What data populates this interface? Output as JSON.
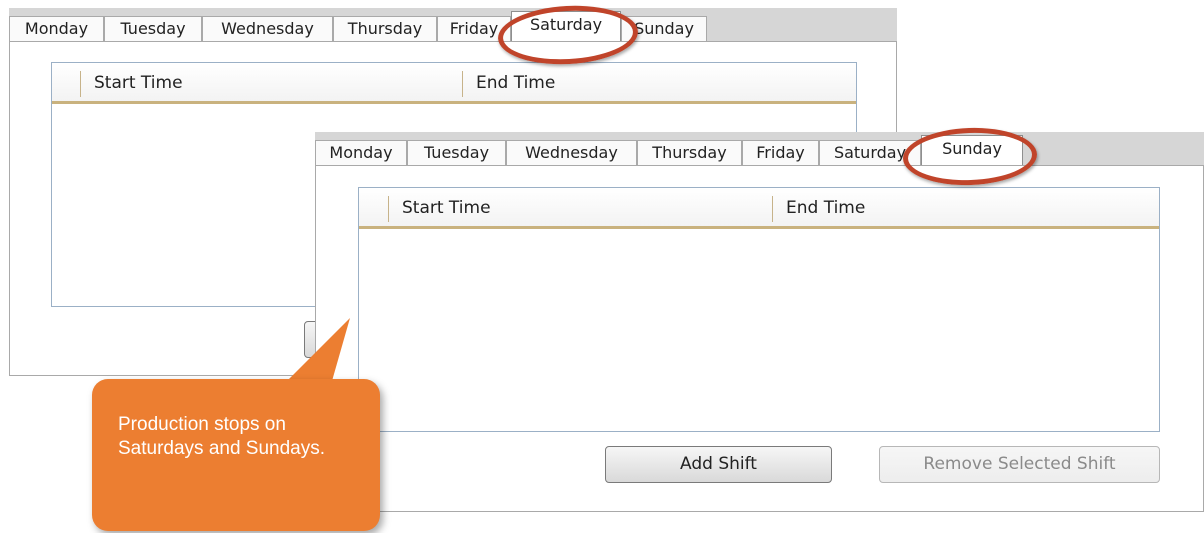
{
  "colors": {
    "tab_bar_bg": "#d6d6d6",
    "grid_border": "#9bb0c6",
    "header_accent": "#c9b27e",
    "highlight_ring": "#c0442a",
    "callout_bg": "#ec7e31",
    "callout_text": "#ffffff"
  },
  "back_window": {
    "tabs": [
      {
        "label": "Monday"
      },
      {
        "label": "Tuesday"
      },
      {
        "label": "Wednesday"
      },
      {
        "label": "Thursday"
      },
      {
        "label": "Friday"
      },
      {
        "label": "Saturday",
        "active": true
      },
      {
        "label": "Sunday"
      }
    ],
    "columns": [
      "Start Time",
      "End Time"
    ]
  },
  "front_window": {
    "tabs": [
      {
        "label": "Monday"
      },
      {
        "label": "Tuesday"
      },
      {
        "label": "Wednesday"
      },
      {
        "label": "Thursday"
      },
      {
        "label": "Friday"
      },
      {
        "label": "Saturday"
      },
      {
        "label": "Sunday",
        "active": true
      }
    ],
    "columns": [
      "Start Time",
      "End Time"
    ],
    "add_shift_label": "Add Shift",
    "remove_shift_label": "Remove Selected Shift"
  },
  "callout": {
    "text": "Production stops on Saturdays and Sundays."
  }
}
